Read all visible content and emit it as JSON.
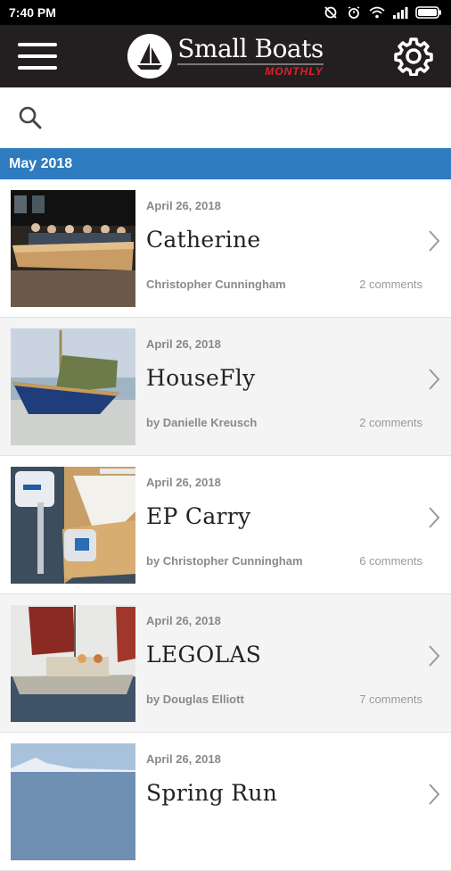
{
  "status": {
    "time": "7:40 PM"
  },
  "app": {
    "title": "Small Boats",
    "subtitle": "MONTHLY"
  },
  "section": {
    "month": "May 2018"
  },
  "articles": [
    {
      "date": "April 26, 2018",
      "title": "Catherine",
      "author": "Christopher Cunningham",
      "comments": "2 comments"
    },
    {
      "date": "April 26, 2018",
      "title": "HouseFly",
      "author": "by Danielle Kreusch",
      "comments": "2 comments"
    },
    {
      "date": "April 26, 2018",
      "title": "EP Carry",
      "author": "by Christopher Cunningham",
      "comments": "6 comments"
    },
    {
      "date": "April 26, 2018",
      "title": "LEGOLAS",
      "author": "by Douglas Elliott",
      "comments": "7 comments"
    },
    {
      "date": "April 26, 2018",
      "title": "Spring Run",
      "author": "",
      "comments": ""
    }
  ],
  "colors": {
    "accent": "#2e7bbf",
    "appbar": "#231f20",
    "brand_red": "#d8232a"
  },
  "icons": [
    "hamburger-icon",
    "gear-icon",
    "search-icon",
    "chevron-right-icon"
  ]
}
